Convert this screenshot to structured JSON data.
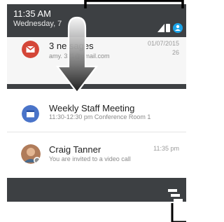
{
  "status_bar": {
    "time": "11:35 AM",
    "date": "Wednesday,                7"
  },
  "notifications": [
    {
      "title": "3 ne        sages",
      "subtitle": "amy.             321@gmail.com",
      "time": "01/07/2015",
      "time_sub": "26",
      "icon": "gmail-icon"
    },
    {
      "title": "Weekly Staff Meeting",
      "subtitle": "11:30-12:30 pm Conference Room 1",
      "icon": "calendar-icon"
    },
    {
      "title": "Craig Tanner",
      "subtitle": "You are invited to a video call",
      "time": "11:35 pm",
      "icon": "avatar"
    }
  ],
  "colors": {
    "shade": "#3d4043",
    "gmail_red": "#d44638",
    "calendar_blue": "#4a74c9",
    "accent_blue": "#1aa3e8"
  }
}
